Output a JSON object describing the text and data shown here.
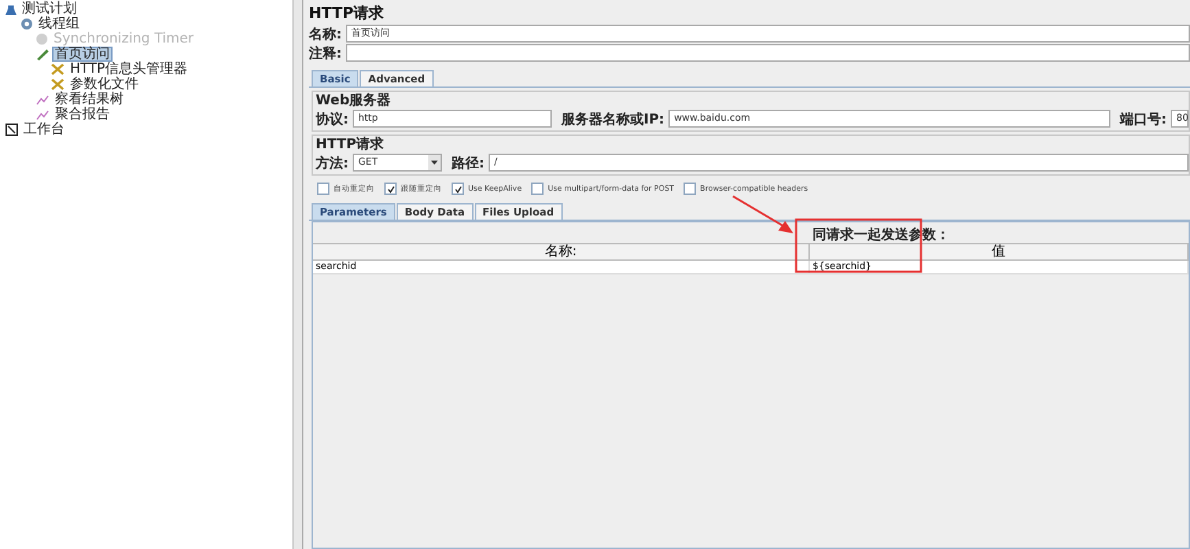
{
  "tree": [
    {
      "label": "测试计划",
      "kind": "plan",
      "selected": false,
      "disabled": false,
      "children": [
        {
          "label": "线程组",
          "kind": "thread-group",
          "selected": false,
          "disabled": false,
          "children": [
            {
              "label": "Synchronizing Timer",
              "kind": "timer",
              "selected": false,
              "disabled": true
            },
            {
              "label": "首页访问",
              "kind": "sampler",
              "selected": true,
              "disabled": false,
              "children": [
                {
                  "label": "HTTP信息头管理器",
                  "kind": "config",
                  "selected": false,
                  "disabled": false
                },
                {
                  "label": "参数化文件",
                  "kind": "config",
                  "selected": false,
                  "disabled": false
                }
              ]
            },
            {
              "label": "察看结果树",
              "kind": "listener",
              "selected": false,
              "disabled": false
            },
            {
              "label": "聚合报告",
              "kind": "listener",
              "selected": false,
              "disabled": false
            }
          ]
        }
      ]
    },
    {
      "label": "工作台",
      "kind": "workbench",
      "selected": false,
      "disabled": false
    }
  ],
  "title": "HTTP请求",
  "name_field": {
    "label": "名称:",
    "value": "首页访问"
  },
  "comment_field": {
    "label": "注释:"
  },
  "tabs": [
    {
      "label": "Basic",
      "selected": true
    },
    {
      "label": "Advanced",
      "selected": false
    }
  ],
  "web_server": {
    "legend": "Web服务器",
    "protocol_label": "协议:",
    "protocol": "http",
    "server_label": "服务器名称或IP:",
    "server": "www.baidu.com",
    "port_label": "端口号:",
    "port": "80"
  },
  "http_request": {
    "legend": "HTTP请求",
    "method_label": "方法:",
    "method": "GET",
    "path_label": "路径:",
    "path": "/"
  },
  "options": [
    {
      "label": "自动重定向",
      "checked": false
    },
    {
      "label": "跟随重定向",
      "checked": true
    },
    {
      "label": "Use KeepAlive",
      "checked": true
    },
    {
      "label": "Use multipart/form-data for POST",
      "checked": false
    },
    {
      "label": "Browser-compatible headers",
      "checked": false
    }
  ],
  "sub_tabs": [
    {
      "label": "Parameters",
      "selected": true
    },
    {
      "label": "Body Data",
      "selected": false
    },
    {
      "label": "Files Upload",
      "selected": false
    }
  ],
  "parameters": {
    "caption": "同请求一起发送参数：",
    "columns": [
      "名称:",
      "值"
    ],
    "rows": [
      [
        "searchid",
        "${searchid}"
      ]
    ]
  }
}
